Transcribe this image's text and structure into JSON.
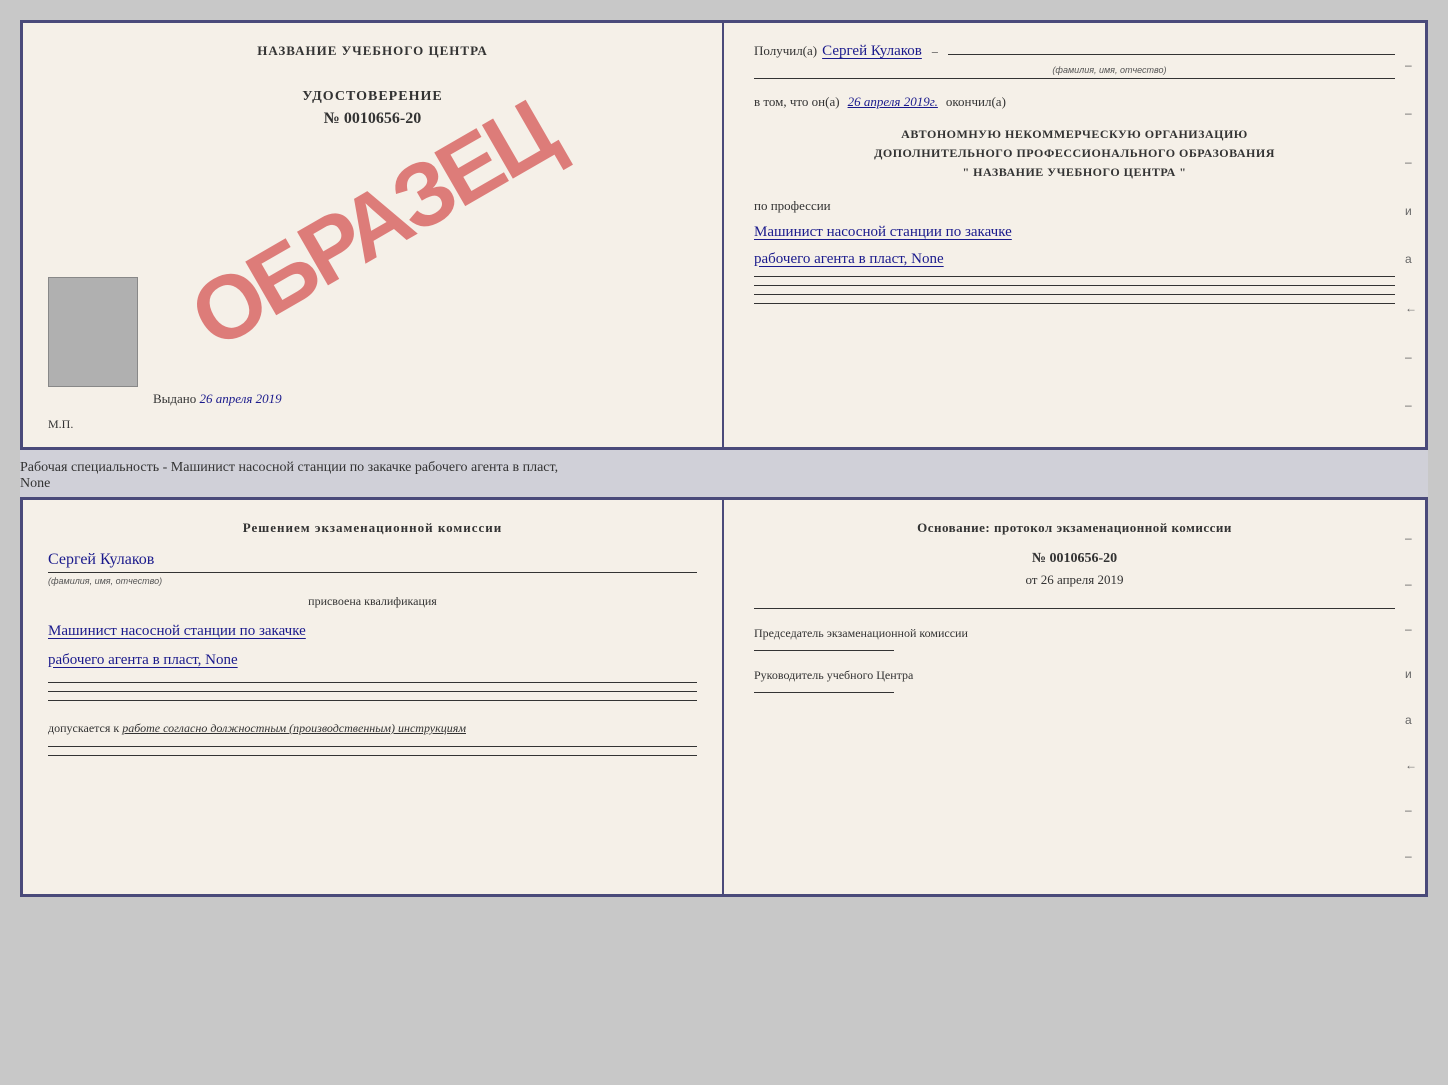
{
  "background": "#c8c8c8",
  "doc_top": {
    "left": {
      "center_title": "НАЗВАНИЕ УЧЕБНОГО ЦЕНТРА",
      "obrazets": "ОБРАЗЕЦ",
      "udostoverenie_label": "УДОСТОВЕРЕНИЕ",
      "udostoverenie_number": "№ 0010656-20",
      "vydano_label": "Выдано",
      "vydano_date": "26 апреля 2019",
      "mp_label": "М.П."
    },
    "right": {
      "poluchil_label": "Получил(а)",
      "recipient_name": "Сергей Кулаков",
      "fio_hint": "(фамилия, имя, отчество)",
      "vtom_label": "в том, что он(а)",
      "date": "26 апреля 2019г.",
      "okonchil_label": "окончил(а)",
      "org_line1": "АВТОНОМНУЮ НЕКОММЕРЧЕСКУЮ ОРГАНИЗАЦИЮ",
      "org_line2": "ДОПОЛНИТЕЛЬНОГО ПРОФЕССИОНАЛЬНОГО ОБРАЗОВАНИЯ",
      "org_line3": "\"   НАЗВАНИЕ УЧЕБНОГО ЦЕНТРА   \"",
      "po_professii_label": "по профессии",
      "profession_line1": "Машинист насосной станции по закачке",
      "profession_line2": "рабочего агента в пласт, None",
      "dashes": [
        "-",
        "-",
        "-",
        "и",
        "а",
        "←",
        "-",
        "-"
      ]
    }
  },
  "separator": {
    "text_line1": "Рабочая специальность - Машинист насосной станции по закачке рабочего агента в пласт,",
    "text_line2": "None"
  },
  "doc_bottom": {
    "left": {
      "resheniem_title": "Решением экзаменационной комиссии",
      "name": "Сергей Кулаков",
      "fio_hint": "(фамилия, имя, отчество)",
      "prisvoena_label": "присвоена квалификация",
      "qualification_line1": "Машинист насосной станции по закачке",
      "qualification_line2": "рабочего агента в пласт, None",
      "dopusk_label": "допускается к",
      "dopusk_text": "работе согласно должностным (производственным) инструкциям"
    },
    "right": {
      "osnovanie_title": "Основание: протокол экзаменационной комиссии",
      "protocol_number": "№ 0010656-20",
      "ot_label": "от",
      "ot_date": "26 апреля 2019",
      "predsedatel_label": "Председатель экзаменационной комиссии",
      "rukovoditel_label": "Руководитель учебного Центра",
      "dashes": [
        "-",
        "-",
        "-",
        "и",
        "а",
        "←",
        "-",
        "-"
      ]
    }
  }
}
